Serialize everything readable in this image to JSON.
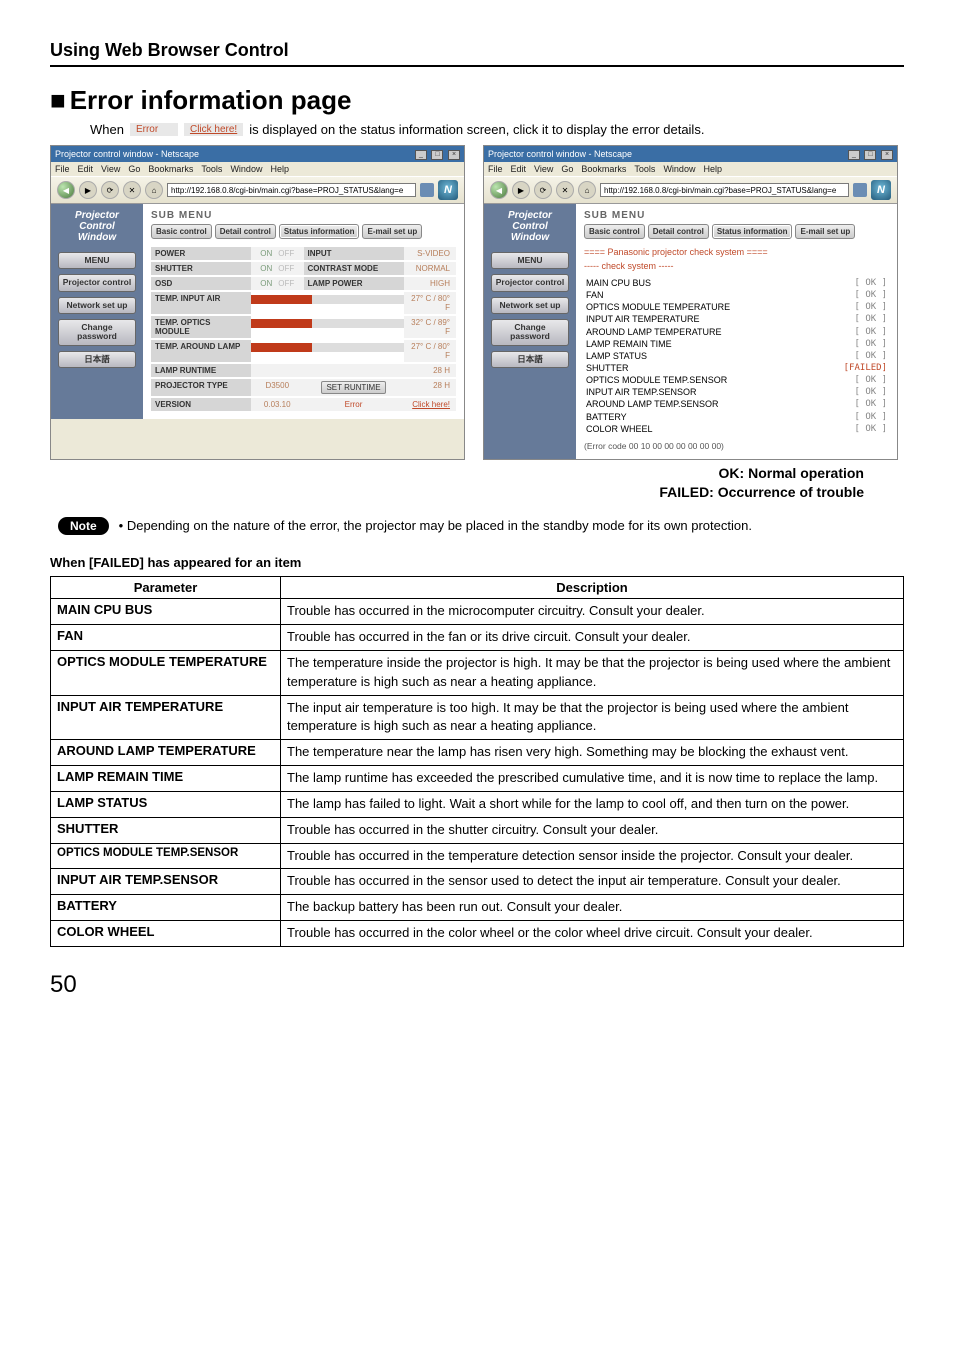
{
  "section_header": "Using Web Browser Control",
  "page_title": "Error information page",
  "when_text_prefix": "When",
  "error_badge": "Error",
  "click_badge": "Click here!",
  "when_text_suffix": "is displayed on the status information screen, click it to display the error details.",
  "browser": {
    "title": "Projector control window - Netscape",
    "win_buttons": [
      "_",
      "□",
      "×"
    ],
    "menubar": [
      "File",
      "Edit",
      "View",
      "Go",
      "Bookmarks",
      "Tools",
      "Window",
      "Help"
    ],
    "url": "http://192.168.0.8/cgi-bin/main.cgi?base=PROJ_STATUS&lang=e",
    "n_logo": "N"
  },
  "sidebar": {
    "heading_lines": [
      "Projector",
      "Control",
      "Window"
    ],
    "buttons": [
      "MENU",
      "Projector control",
      "Network set up",
      "Change password",
      "日本語"
    ]
  },
  "sub_menu_label": "SUB MENU",
  "tabs": [
    "Basic control",
    "Detail control",
    "Status information",
    "E-mail set up"
  ],
  "left_status": {
    "rows": [
      {
        "l_label": "POWER",
        "l_val": "onoff",
        "r_label": "INPUT",
        "r_val": "S-VIDEO"
      },
      {
        "l_label": "SHUTTER",
        "l_val": "onoff",
        "r_label": "CONTRAST MODE",
        "r_val": "NORMAL"
      },
      {
        "l_label": "OSD",
        "l_val": "onoff",
        "r_label": "LAMP POWER",
        "r_val": "HIGH"
      }
    ],
    "temp_rows": [
      {
        "label": "TEMP. INPUT AIR",
        "val": "27° C / 80° F"
      },
      {
        "label": "TEMP. OPTICS MODULE",
        "val": "32° C / 89° F"
      },
      {
        "label": "TEMP. AROUND LAMP",
        "val": "27° C / 80° F"
      }
    ],
    "runtime_rows": [
      {
        "label": "LAMP RUNTIME",
        "val": "28 H"
      },
      {
        "label": "PROJECTOR TYPE",
        "mid": "D3500",
        "btn": "SET RUNTIME",
        "val": "28 H"
      },
      {
        "label": "VERSION",
        "mid": "0.03.10",
        "r_label": "Error",
        "link": "Click here!"
      }
    ],
    "on_label": "ON",
    "off_label": "OFF"
  },
  "right_check": {
    "heading": "==== Panasonic projector check system ====",
    "sub": "----- check system -----",
    "items": [
      {
        "name": "MAIN CPU BUS",
        "status": "[ OK ]"
      },
      {
        "name": "FAN",
        "status": "[ OK ]"
      },
      {
        "name": "OPTICS MODULE TEMPERATURE",
        "status": "[ OK ]"
      },
      {
        "name": "INPUT AIR TEMPERATURE",
        "status": "[ OK ]"
      },
      {
        "name": "AROUND LAMP TEMPERATURE",
        "status": "[ OK ]"
      },
      {
        "name": "LAMP REMAIN TIME",
        "status": "[ OK ]"
      },
      {
        "name": "LAMP STATUS",
        "status": "[ OK ]"
      },
      {
        "name": "SHUTTER",
        "status": "[FAILED]",
        "fail": true
      },
      {
        "name": "OPTICS MODULE TEMP.SENSOR",
        "status": "[ OK ]"
      },
      {
        "name": "INPUT AIR TEMP.SENSOR",
        "status": "[ OK ]"
      },
      {
        "name": "AROUND LAMP TEMP.SENSOR",
        "status": "[ OK ]"
      },
      {
        "name": "BATTERY",
        "status": "[ OK ]"
      },
      {
        "name": "COLOR WHEEL",
        "status": "[ OK ]"
      }
    ],
    "error_code": "(Error code 00 10 00 00 00 00 00 00)"
  },
  "legend_ok": "OK: Normal operation",
  "legend_failed": "FAILED: Occurrence of trouble",
  "note_label": "Note",
  "note_text": "• Depending on the nature of the error, the projector may be placed in the standby mode for its own protection.",
  "subheading": "When [FAILED] has appeared for an item",
  "param_table": {
    "headers": [
      "Parameter",
      "Description"
    ],
    "rows": [
      {
        "param": "MAIN CPU BUS",
        "desc": "Trouble has occurred in the microcomputer circuitry. Consult your dealer."
      },
      {
        "param": "FAN",
        "desc": "Trouble has occurred in the fan or its drive circuit. Consult your dealer."
      },
      {
        "param": "OPTICS MODULE TEMPERATURE",
        "desc": "The temperature inside the projector is high. It may be that the projector is being used where the ambient temperature is high such as near a heating appliance."
      },
      {
        "param": "INPUT AIR TEMPERATURE",
        "desc": "The input air temperature is too high. It may be that the projector is being used where the ambient temperature is high such as near a heating appliance."
      },
      {
        "param": "AROUND LAMP TEMPERATURE",
        "desc": "The temperature near the lamp has risen very high. Something may be blocking the exhaust vent."
      },
      {
        "param": "LAMP REMAIN TIME",
        "desc": "The lamp runtime has exceeded the prescribed cumulative time, and it is now time to replace the lamp."
      },
      {
        "param": "LAMP STATUS",
        "desc": "The lamp has failed to light. Wait a short while for the lamp to cool off, and then turn on the power."
      },
      {
        "param": "SHUTTER",
        "desc": "Trouble has occurred in the shutter circuitry. Consult your dealer."
      },
      {
        "param": "OPTICS MODULE TEMP.SENSOR",
        "small": true,
        "desc": "Trouble has occurred in the temperature detection sensor inside the projector. Consult your dealer."
      },
      {
        "param": "INPUT AIR TEMP.SENSOR",
        "desc": "Trouble has occurred in the sensor used to detect the input air temperature. Consult your dealer."
      },
      {
        "param": "BATTERY",
        "desc": "The backup battery has been run out. Consult your dealer."
      },
      {
        "param": "COLOR WHEEL",
        "desc": "Trouble has occurred in the color wheel or the color wheel drive circuit. Consult your dealer."
      }
    ]
  },
  "page_number": "50"
}
